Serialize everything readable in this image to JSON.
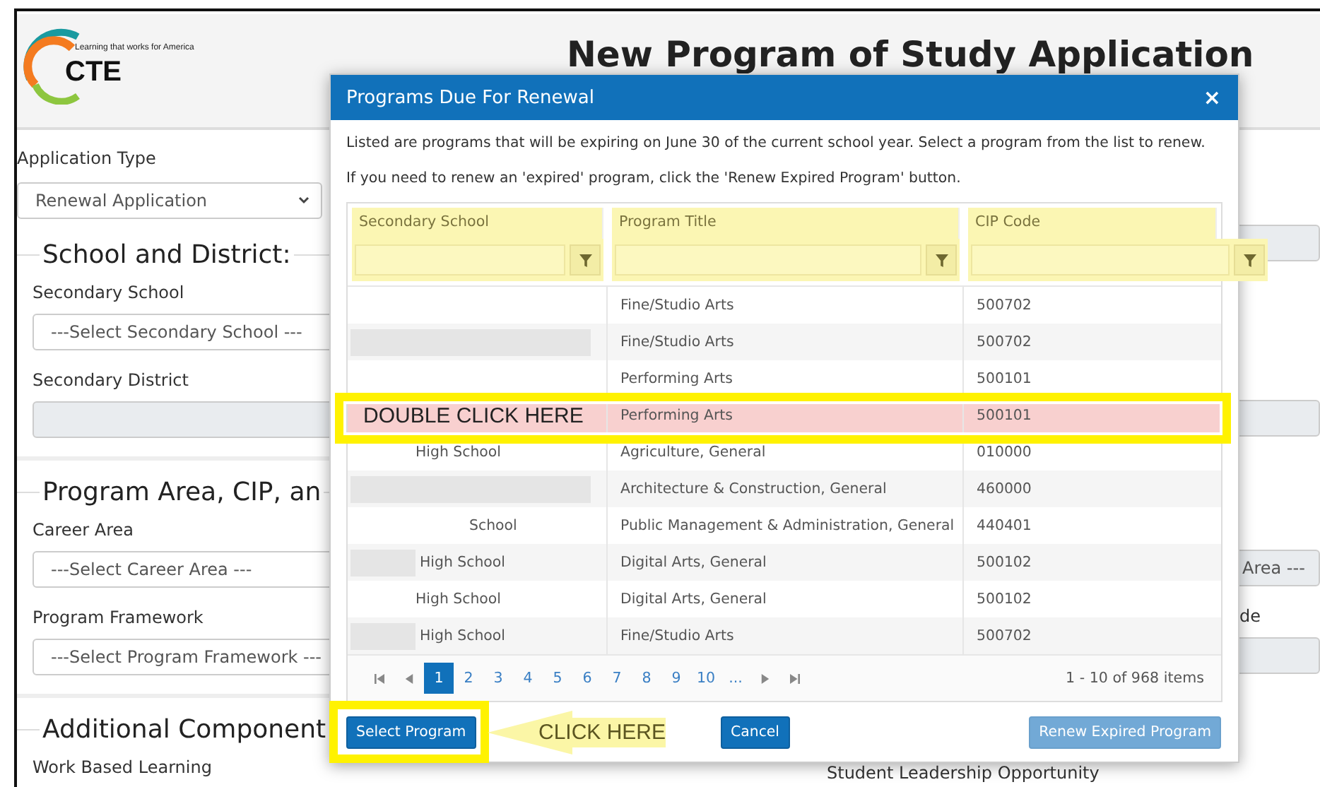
{
  "header": {
    "logo": {
      "tagline": "Learning that works for America",
      "name": "CTE"
    },
    "title": "New Program of Study Application"
  },
  "form": {
    "application_type": {
      "label": "Application Type",
      "value": "Renewal Application"
    },
    "sections": [
      {
        "legend": "School and District:",
        "items": [
          {
            "kind": "label",
            "text": "Secondary School"
          },
          {
            "kind": "select",
            "text": "---Select Secondary School ---"
          },
          {
            "kind": "label",
            "text": "Secondary District"
          },
          {
            "kind": "readonly"
          }
        ]
      },
      {
        "legend": "Program Area, CIP, an",
        "items": [
          {
            "kind": "label",
            "text": "Career Area"
          },
          {
            "kind": "select",
            "text": "---Select Career Area ---"
          },
          {
            "kind": "label",
            "text": "Program Framework"
          },
          {
            "kind": "select",
            "text": "---Select Program Framework ---"
          }
        ]
      },
      {
        "legend": "Additional Component",
        "items": [
          {
            "kind": "label",
            "text": "Work Based Learning"
          }
        ]
      }
    ],
    "right_column": [
      {
        "kind": "readonly"
      },
      {
        "kind": "readonly"
      },
      {
        "kind": "readonly",
        "text": "Area ---"
      },
      {
        "kind": "label",
        "text": "de"
      },
      {
        "kind": "readonly"
      },
      {
        "kind": "label",
        "text": "Student Leadership Opportunity"
      }
    ]
  },
  "modal": {
    "title": "Programs Due For Renewal",
    "close": "×",
    "intro": [
      "Listed are programs that will be expiring on June 30 of the current school year. Select a program from the list to renew.",
      "If you need to renew an 'expired' program, click the 'Renew Expired Program' button."
    ],
    "table": {
      "columns": [
        "Secondary School",
        "Program Title",
        "CIP Code"
      ],
      "rows": [
        {
          "kind": "plain",
          "title": "Fine/Studio Arts",
          "cip": "500702",
          "selected": false
        },
        {
          "kind": "redactedlong",
          "title": "Fine/Studio Arts",
          "cip": "500702",
          "selected": false
        },
        {
          "kind": "plain",
          "title": "Performing Arts",
          "cip": "500101",
          "selected": false
        },
        {
          "kind": "plain",
          "title": "Performing Arts",
          "cip": "500101",
          "selected": true
        },
        {
          "kind": "indented",
          "school": "High School",
          "title": "Agriculture, General",
          "cip": "010000",
          "selected": false
        },
        {
          "kind": "redactedlong",
          "title": "Architecture & Construction, General",
          "cip": "460000",
          "selected": false
        },
        {
          "kind": "indentedwide",
          "school": "School",
          "title": "Public Management & Administration, General",
          "cip": "440401",
          "selected": false
        },
        {
          "kind": "redactedshort",
          "school": "High School",
          "title": "Digital Arts, General",
          "cip": "500102",
          "selected": false
        },
        {
          "kind": "indented",
          "school": "High School",
          "title": "Digital Arts, General",
          "cip": "500102",
          "selected": false
        },
        {
          "kind": "redactedshort",
          "school": "High School",
          "title": "Fine/Studio Arts",
          "cip": "500702",
          "selected": false
        }
      ]
    },
    "pager": {
      "pages": [
        {
          "label": "1",
          "selected": true
        },
        {
          "label": "2",
          "selected": false
        },
        {
          "label": "3",
          "selected": false
        },
        {
          "label": "4",
          "selected": false
        },
        {
          "label": "5",
          "selected": false
        },
        {
          "label": "6",
          "selected": false
        },
        {
          "label": "7",
          "selected": false
        },
        {
          "label": "8",
          "selected": false
        },
        {
          "label": "9",
          "selected": false
        },
        {
          "label": "10",
          "selected": false
        },
        {
          "label": "...",
          "selected": false
        }
      ],
      "info": "1 - 10 of 968 items"
    },
    "buttons": [
      {
        "kind": "primary",
        "label": "Select Program"
      },
      {
        "kind": "primary",
        "label": "Cancel"
      },
      {
        "kind": "faded",
        "label": "Renew Expired Program"
      }
    ]
  },
  "annotations": [
    {
      "kind": "row_box",
      "text": "DOUBLE CLICK HERE"
    },
    {
      "kind": "button_box"
    },
    {
      "kind": "arrow",
      "text": "CLICK HERE"
    }
  ]
}
